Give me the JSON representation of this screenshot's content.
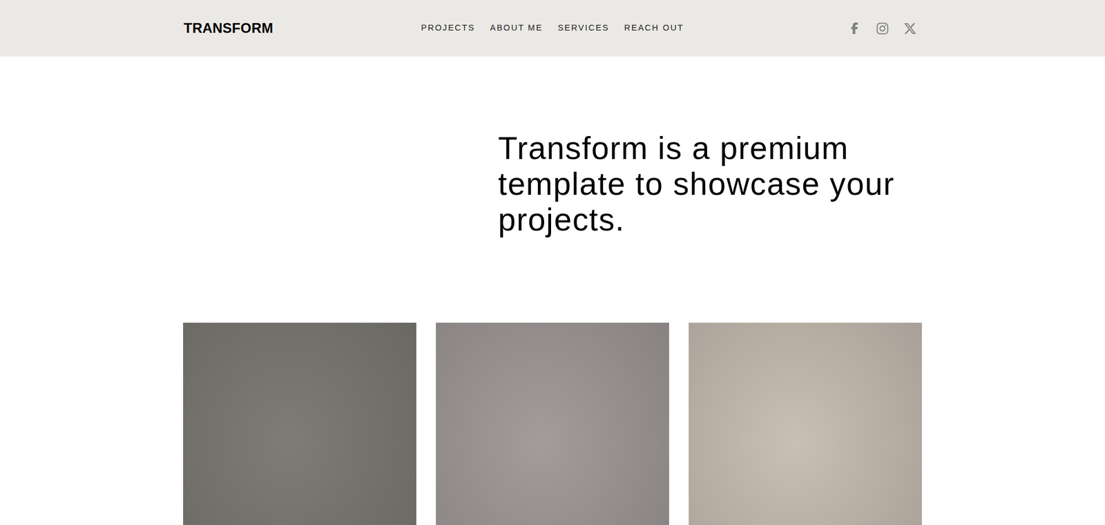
{
  "header": {
    "logo": "TRANSFORM",
    "nav": [
      {
        "label": "PROJECTS"
      },
      {
        "label": "ABOUT ME"
      },
      {
        "label": "SERVICES"
      },
      {
        "label": "REACH OUT"
      }
    ]
  },
  "hero": {
    "heading": "Transform is a premium template to showcase your projects."
  },
  "projects": [
    {
      "color": "#7f7c76"
    },
    {
      "color": "#a29c9b"
    },
    {
      "color": "#c9c0b4"
    }
  ]
}
